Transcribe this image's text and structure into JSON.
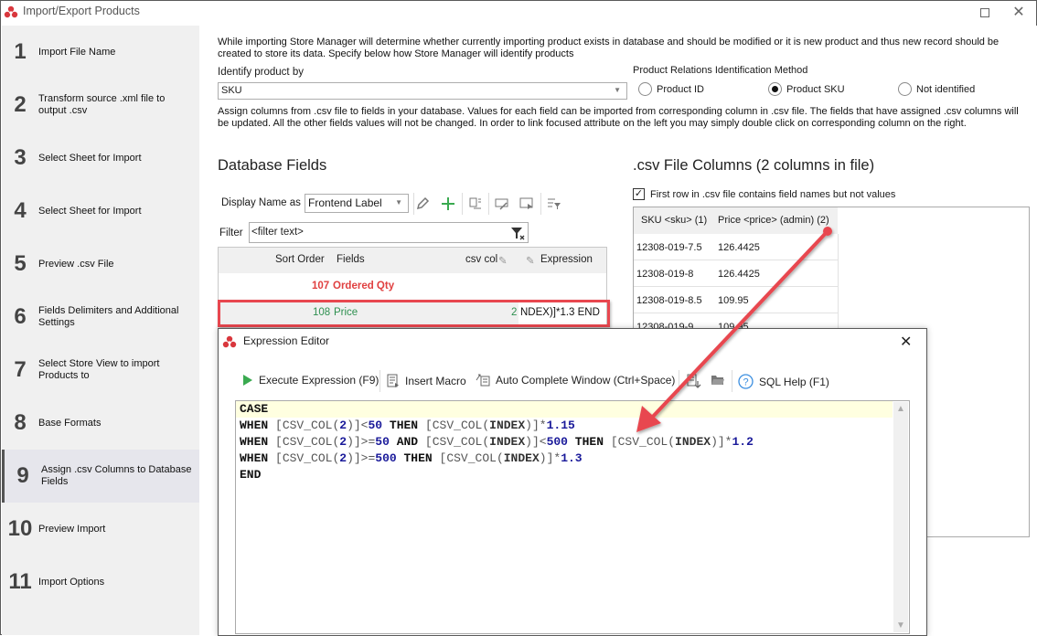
{
  "window": {
    "title": "Import/Export Products",
    "maximize_icon": "maximize-icon",
    "close_icon": "close-icon"
  },
  "sidebar": {
    "steps": [
      {
        "num": "1",
        "label": "Import File Name"
      },
      {
        "num": "2",
        "label": "Transform source .xml file to output .csv"
      },
      {
        "num": "3",
        "label": "Select Sheet for Import"
      },
      {
        "num": "4",
        "label": "Select Sheet for Import"
      },
      {
        "num": "5",
        "label": "Preview .csv File"
      },
      {
        "num": "6",
        "label": "Fields Delimiters and Additional Settings"
      },
      {
        "num": "7",
        "label": "Select Store View to import Products to"
      },
      {
        "num": "8",
        "label": "Base Formats"
      },
      {
        "num": "9",
        "label": "Assign .csv Columns to Database Fields",
        "active": true
      },
      {
        "num": "10",
        "label": "Preview Import"
      },
      {
        "num": "11",
        "label": "Import Options"
      }
    ]
  },
  "main": {
    "intro": "While importing Store Manager will determine whether currently importing product exists in database and should be modified or it is new product and thus new record should be created to store its data. Specify below how Store Manager will identify products",
    "identify_label": "Identify product by",
    "identify_value": "SKU",
    "relations_label": "Product Relations Identification Method",
    "relations_options": [
      {
        "label": "Product ID",
        "checked": false
      },
      {
        "label": "Product SKU",
        "checked": true
      },
      {
        "label": "Not identified",
        "checked": false
      }
    ],
    "assign_text": "Assign columns from .csv file to fields in your database. Values for each field can be imported from corresponding column in .csv file. The fields that have assigned .csv columns will be updated. All the other fields values will not be changed. In order to link focused attribute on the left you may simply double click on corresponding column on the right.",
    "db_fields": {
      "title": "Database Fields",
      "display_name_label": "Display Name as",
      "display_name_value": "Frontend Label",
      "filter_label": "Filter",
      "filter_placeholder": "<filter text>",
      "columns": [
        "Sort Order",
        "Fields",
        "csv col",
        "Expression"
      ],
      "rows": [
        {
          "sort_order": "107",
          "field": "Ordered Qty",
          "csv_col": "",
          "expression": "",
          "color": "#e04040"
        },
        {
          "sort_order": "108",
          "field": "Price",
          "csv_col": "2",
          "expression": "NDEX)]*1.3 END",
          "color": "#2e9050"
        }
      ]
    },
    "csv_columns": {
      "title": ".csv File Columns (2 columns in file)",
      "first_row_label": "First row in .csv file contains field names but not values",
      "first_row_checked": true,
      "headers": [
        "SKU <sku> (1)",
        "Price <price> (admin) (2)"
      ],
      "rows": [
        [
          "12308-019-7.5",
          "126.4425"
        ],
        [
          "12308-019-8",
          "126.4425"
        ],
        [
          "12308-019-8.5",
          "109.95"
        ],
        [
          "12308-019-9",
          "109.95"
        ]
      ]
    }
  },
  "expression_editor": {
    "title": "Expression Editor",
    "toolbar": {
      "execute": "Execute Expression (F9)",
      "insert_macro": "Insert Macro",
      "auto_complete": "Auto Complete Window (Ctrl+Space)",
      "sql_help": "SQL Help (F1)"
    },
    "code": {
      "line1": "CASE",
      "line5": "END"
    },
    "tokens": {
      "when": "WHEN",
      "then": "THEN",
      "and": "AND",
      "csv_col_open": "[CSV_COL(",
      "two": "2",
      "close": ")]",
      "index_open": "[CSV_COL(",
      "index": "INDEX",
      "lt": "<",
      "gte": ">=",
      "times": "*",
      "v50": "50",
      "v500": "500",
      "m115": "1.15",
      "m12": "1.2",
      "m13": "1.3"
    }
  },
  "colors": {
    "highlight": "#e8474f",
    "ordered_qty": "#e04040",
    "price_row": "#2e9050",
    "current_line": "#ffffe0"
  }
}
